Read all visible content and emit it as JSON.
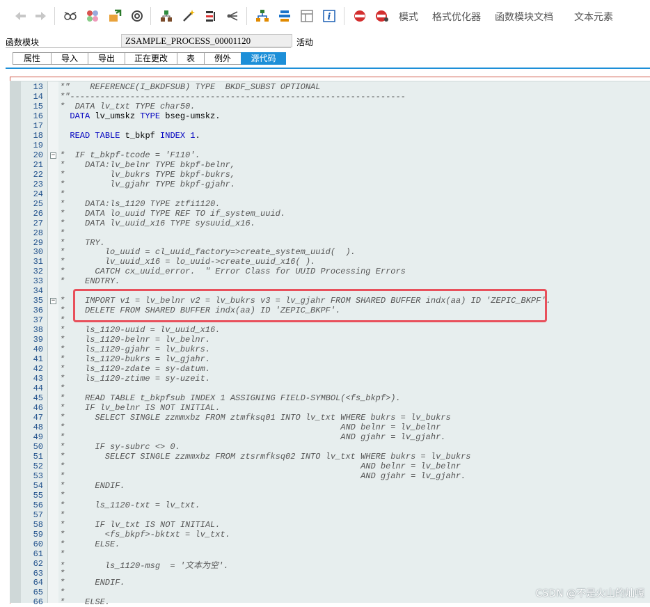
{
  "toolbar": {
    "labels": [
      "模式",
      "格式优化器",
      "函数模块文档",
      "文本元素"
    ]
  },
  "header": {
    "field_label": "函数模块",
    "field_value": "ZSAMPLE_PROCESS_00001120",
    "status": "活动"
  },
  "tabs": [
    "属性",
    "导入",
    "导出",
    "正在更改",
    "表",
    "例外",
    "源代码"
  ],
  "editor": {
    "lines": [
      {
        "n": "13",
        "t": "*\"    REFERENCE(I_BKDFSUB) TYPE  BKDF_SUBST OPTIONAL",
        "k": "comment"
      },
      {
        "n": "14",
        "t": "*\"-------------------------------------------------------------------",
        "k": "comment"
      },
      {
        "n": "15",
        "t": "*  DATA lv_txt TYPE char50.",
        "k": "comment"
      },
      {
        "n": "16",
        "t": "  DATA lv_umskz TYPE bseg-umskz.",
        "k": "code"
      },
      {
        "n": "17",
        "t": "",
        "k": "code"
      },
      {
        "n": "18",
        "t": "  READ TABLE t_bkpf INDEX 1.",
        "k": "code"
      },
      {
        "n": "19",
        "t": "",
        "k": "code"
      },
      {
        "n": "20",
        "t": "*  IF t_bkpf-tcode = 'F110'.",
        "k": "comment",
        "fold": true
      },
      {
        "n": "21",
        "t": "*    DATA:lv_belnr TYPE bkpf-belnr,",
        "k": "comment"
      },
      {
        "n": "22",
        "t": "*         lv_bukrs TYPE bkpf-bukrs,",
        "k": "comment"
      },
      {
        "n": "23",
        "t": "*         lv_gjahr TYPE bkpf-gjahr.",
        "k": "comment"
      },
      {
        "n": "24",
        "t": "*",
        "k": "comment"
      },
      {
        "n": "25",
        "t": "*    DATA:ls_1120 TYPE ztfi1120.",
        "k": "comment"
      },
      {
        "n": "26",
        "t": "*    DATA lo_uuid TYPE REF TO if_system_uuid.",
        "k": "comment"
      },
      {
        "n": "27",
        "t": "*    DATA lv_uuid_x16 TYPE sysuuid_x16.",
        "k": "comment"
      },
      {
        "n": "28",
        "t": "*",
        "k": "comment"
      },
      {
        "n": "29",
        "t": "*    TRY.",
        "k": "comment"
      },
      {
        "n": "30",
        "t": "*        lo_uuid = cl_uuid_factory=>create_system_uuid(  ).",
        "k": "comment"
      },
      {
        "n": "31",
        "t": "*        lv_uuid_x16 = lo_uuid->create_uuid_x16( ).",
        "k": "comment"
      },
      {
        "n": "32",
        "t": "*      CATCH cx_uuid_error.  \" Error Class for UUID Processing Errors",
        "k": "comment"
      },
      {
        "n": "33",
        "t": "*    ENDTRY.",
        "k": "comment"
      },
      {
        "n": "34",
        "t": "",
        "k": "code"
      },
      {
        "n": "35",
        "t": "*    IMPORT v1 = lv_belnr v2 = lv_bukrs v3 = lv_gjahr FROM SHARED BUFFER indx(aa) ID 'ZEPIC_BKPF'.",
        "k": "comment",
        "fold": true
      },
      {
        "n": "36",
        "t": "*    DELETE FROM SHARED BUFFER indx(aa) ID 'ZEPIC_BKPF'.",
        "k": "comment"
      },
      {
        "n": "37",
        "t": "*",
        "k": "comment"
      },
      {
        "n": "38",
        "t": "*    ls_1120-uuid = lv_uuid_x16.",
        "k": "comment"
      },
      {
        "n": "39",
        "t": "*    ls_1120-belnr = lv_belnr.",
        "k": "comment"
      },
      {
        "n": "40",
        "t": "*    ls_1120-gjahr = lv_bukrs.",
        "k": "comment"
      },
      {
        "n": "41",
        "t": "*    ls_1120-bukrs = lv_gjahr.",
        "k": "comment"
      },
      {
        "n": "42",
        "t": "*    ls_1120-zdate = sy-datum.",
        "k": "comment"
      },
      {
        "n": "43",
        "t": "*    ls_1120-ztime = sy-uzeit.",
        "k": "comment"
      },
      {
        "n": "44",
        "t": "*",
        "k": "comment"
      },
      {
        "n": "45",
        "t": "*    READ TABLE t_bkpfsub INDEX 1 ASSIGNING FIELD-SYMBOL(<fs_bkpf>).",
        "k": "comment"
      },
      {
        "n": "46",
        "t": "*    IF lv_belnr IS NOT INITIAL.",
        "k": "comment"
      },
      {
        "n": "47",
        "t": "*      SELECT SINGLE zzmmxbz FROM ztmfksq01 INTO lv_txt WHERE bukrs = lv_bukrs",
        "k": "comment"
      },
      {
        "n": "48",
        "t": "*                                                       AND belnr = lv_belnr",
        "k": "comment"
      },
      {
        "n": "49",
        "t": "*                                                       AND gjahr = lv_gjahr.",
        "k": "comment"
      },
      {
        "n": "50",
        "t": "*      IF sy-subrc <> 0.",
        "k": "comment"
      },
      {
        "n": "51",
        "t": "*        SELECT SINGLE zzmmxbz FROM ztsrmfksq02 INTO lv_txt WHERE bukrs = lv_bukrs",
        "k": "comment"
      },
      {
        "n": "52",
        "t": "*                                                           AND belnr = lv_belnr",
        "k": "comment"
      },
      {
        "n": "53",
        "t": "*                                                           AND gjahr = lv_gjahr.",
        "k": "comment"
      },
      {
        "n": "54",
        "t": "*      ENDIF.",
        "k": "comment"
      },
      {
        "n": "55",
        "t": "*",
        "k": "comment"
      },
      {
        "n": "56",
        "t": "*      ls_1120-txt = lv_txt.",
        "k": "comment"
      },
      {
        "n": "57",
        "t": "*",
        "k": "comment"
      },
      {
        "n": "58",
        "t": "*      IF lv_txt IS NOT INITIAL.",
        "k": "comment"
      },
      {
        "n": "59",
        "t": "*        <fs_bkpf>-bktxt = lv_txt.",
        "k": "comment"
      },
      {
        "n": "60",
        "t": "*      ELSE.",
        "k": "comment"
      },
      {
        "n": "61",
        "t": "*",
        "k": "comment"
      },
      {
        "n": "62",
        "t": "*        ls_1120-msg  = '文本为空'.",
        "k": "comment"
      },
      {
        "n": "63",
        "t": "*",
        "k": "comment"
      },
      {
        "n": "64",
        "t": "*      ENDIF.",
        "k": "comment"
      },
      {
        "n": "65",
        "t": "*",
        "k": "comment"
      },
      {
        "n": "66",
        "t": "*    ELSE.",
        "k": "comment"
      }
    ]
  },
  "watermark": "CSDN @不是火山的灿嘎"
}
